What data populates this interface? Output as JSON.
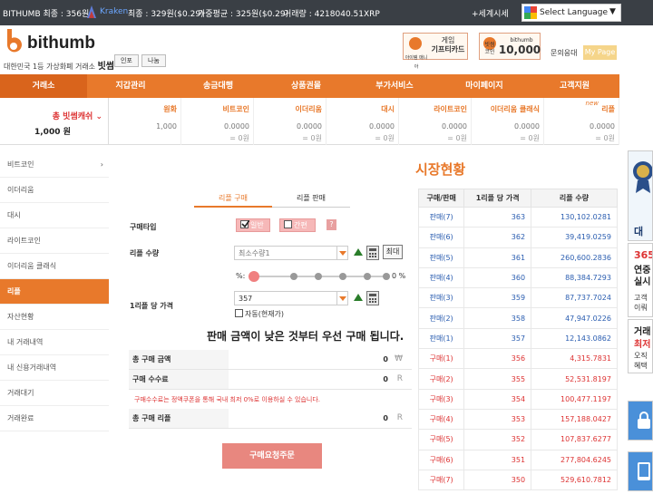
{
  "topbar": {
    "bithumb_last": "BITHUMB 최종 : 356원",
    "kraken": "Kraken",
    "kraken_last": "최종 : 329원($0.29)",
    "kraken_avg": "가중평균 : 325원($0.29)",
    "kraken_vol": "거래량 : 4218040.51XRP",
    "world_time": "+세계시세",
    "select_language": "Select Language"
  },
  "brand": {
    "name": "bithumb",
    "tagline": "대한민국 1등 가상화폐 거래소",
    "tagline_bold": "빗썸",
    "lang_buttons": [
      "인포",
      "나눔"
    ]
  },
  "promos": [
    {
      "l1": "게임",
      "l2": "기프티카드",
      "tag": "아이템 매니아"
    },
    {
      "l1": "빗썸",
      "l2": "코인",
      "big": "10,000",
      "tag": "bithumb"
    }
  ],
  "header": {
    "cs": "문의응대",
    "mypage": "My Page"
  },
  "nav": [
    "거래소",
    "지갑관리",
    "송금대행",
    "상품권몰",
    "부가서비스",
    "마이페이지",
    "고객지원"
  ],
  "coinsum": {
    "total_label": "총 빗썸캐쉬",
    "total_value": "1,000 원",
    "new_badge": "new",
    "cols": [
      {
        "name": "원화",
        "v1": "1,000",
        "v2": ""
      },
      {
        "name": "비트코인",
        "v1": "0.0000",
        "v2": "= 0원"
      },
      {
        "name": "이더리움",
        "v1": "0.0000",
        "v2": "= 0원"
      },
      {
        "name": "대시",
        "v1": "0.0000",
        "v2": "= 0원"
      },
      {
        "name": "라이트코인",
        "v1": "0.0000",
        "v2": "= 0원"
      },
      {
        "name": "이더리움 클래식",
        "v1": "0.0000",
        "v2": "= 0원"
      },
      {
        "name": "리플",
        "v1": "0.0000",
        "v2": "= 0원"
      }
    ]
  },
  "sidebar": [
    "비트코인",
    "이더리움",
    "대시",
    "라이트코인",
    "이더리움 클래식",
    "리플",
    "자산현황",
    "내 거래내역",
    "내 신용거래내역",
    "거래대기",
    "거래완료"
  ],
  "sidebar_active": 5,
  "order": {
    "tab_buy": "리플 구매",
    "tab_sell": "리플 판매",
    "type_label": "구매타입",
    "type_normal": "일반",
    "type_easy": "간편 구매",
    "qty_label": "리플 수량",
    "qty_placeholder": "최소수량1",
    "max_btn": "최대",
    "pct_left": "%:",
    "pct_right": "0 %",
    "price_label": "1리플 당 가격",
    "price_value": "357",
    "auto_label": "자동(현재가)",
    "notice": "판매 금액이 낮은 것부터 우선 구매 됩니다.",
    "total_label": "총 구매 금액",
    "total_value": "0",
    "total_unit": "₩",
    "fee_label": "구매 수수료",
    "fee_value": "0",
    "fee_unit": "R",
    "fee_note": "구매수수료는 정액쿠폰을 통해 국내 최저 0%로 이용하실 수 있습니다.",
    "qtytotal_label": "총 구매 리플",
    "qtytotal_value": "0",
    "qtytotal_unit": "R",
    "submit": "구매요청주문"
  },
  "market": {
    "title": "시장현황",
    "headers": [
      "구매/판매",
      "1리플 당 가격",
      "리플 수량"
    ],
    "rows": [
      {
        "type": "판매(7)",
        "price": "363",
        "qty": "130,102.0281",
        "side": "sell"
      },
      {
        "type": "판매(6)",
        "price": "362",
        "qty": "39,419.0259",
        "side": "sell"
      },
      {
        "type": "판매(5)",
        "price": "361",
        "qty": "260,600.2836",
        "side": "sell"
      },
      {
        "type": "판매(4)",
        "price": "360",
        "qty": "88,384.7293",
        "side": "sell"
      },
      {
        "type": "판매(3)",
        "price": "359",
        "qty": "87,737.7024",
        "side": "sell"
      },
      {
        "type": "판매(2)",
        "price": "358",
        "qty": "47,947.0226",
        "side": "sell"
      },
      {
        "type": "판매(1)",
        "price": "357",
        "qty": "12,143.0862",
        "side": "sell"
      },
      {
        "type": "구매(1)",
        "price": "356",
        "qty": "4,315.7831",
        "side": "buy"
      },
      {
        "type": "구매(2)",
        "price": "355",
        "qty": "52,531.8197",
        "side": "buy"
      },
      {
        "type": "구매(3)",
        "price": "354",
        "qty": "100,477.1197",
        "side": "buy"
      },
      {
        "type": "구매(4)",
        "price": "353",
        "qty": "157,188.0427",
        "side": "buy"
      },
      {
        "type": "구매(5)",
        "price": "352",
        "qty": "107,837.6277",
        "side": "buy"
      },
      {
        "type": "구매(6)",
        "price": "351",
        "qty": "277,804.6245",
        "side": "buy"
      },
      {
        "type": "구매(7)",
        "price": "350",
        "qty": "529,610.7812",
        "side": "buy"
      }
    ]
  },
  "right_ads": [
    {
      "t": "대한"
    },
    {
      "t": "365°",
      "t2": "연중",
      "t3": "실시",
      "t4": "고객",
      "t5": "이뤄"
    },
    {
      "t": "거래",
      "t2": "최저",
      "t3": "오직",
      "t4": "혜택"
    }
  ],
  "colors": {
    "accent": "#e8792b",
    "sell": "#2a5db0",
    "buy": "#d33333"
  }
}
